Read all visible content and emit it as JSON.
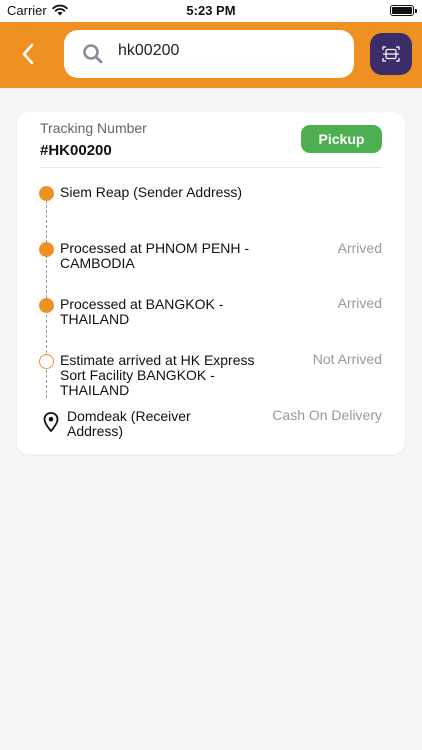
{
  "status_bar": {
    "carrier": "Carrier",
    "time": "5:23 PM"
  },
  "search": {
    "value": "hk00200"
  },
  "colors": {
    "header": "#ef9122",
    "scan_button": "#3a2d69",
    "badge": "#4caf50",
    "dot": "#ef9122"
  },
  "icons": {
    "back": "chevron-left-icon",
    "search": "search-icon",
    "scan": "scan-icon",
    "receiver": "map-pin-icon"
  },
  "tracking": {
    "label": "Tracking Number",
    "number": "#HK00200",
    "badge": "Pickup"
  },
  "steps": [
    {
      "title": "Siem Reap (Sender Address)",
      "status": ""
    },
    {
      "title": "Processed at PHNOM PENH - CAMBODIA",
      "status": "Arrived"
    },
    {
      "title": "Processed at BANGKOK - THAILAND",
      "status": "Arrived"
    },
    {
      "title": "Estimate arrived at HK Express Sort Facility BANGKOK - THAILAND",
      "status": "Not Arrived"
    },
    {
      "title": "Domdeak (Receiver Address)",
      "status": "Cash On Delivery"
    }
  ]
}
